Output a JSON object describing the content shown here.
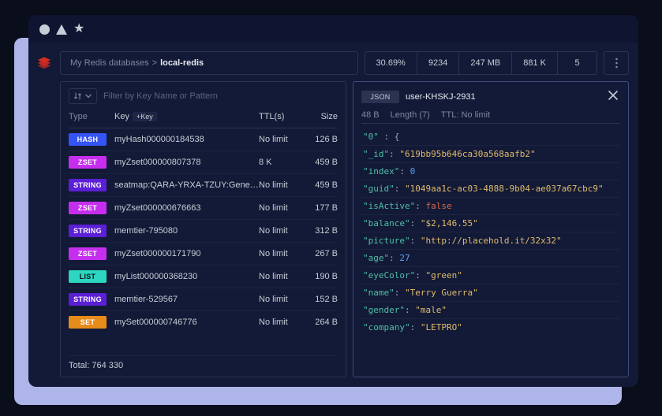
{
  "breadcrumb": {
    "root": "My Redis databases",
    "sep": ">",
    "current": "local-redis"
  },
  "stats": {
    "pct": "30.69%",
    "s1": "9234",
    "size": "247 MB",
    "keys": "881 K",
    "extra": "5"
  },
  "filter": {
    "placeholder": "Filter by Key Name or Pattern"
  },
  "headers": {
    "type": "Type",
    "key": "Key",
    "add": "+Key",
    "ttl": "TTL(s)",
    "size": "Size"
  },
  "rows": [
    {
      "type": "HASH",
      "key": "myHash000000184538",
      "ttl": "No limit",
      "size": "126 B"
    },
    {
      "type": "ZSET",
      "key": "myZset000000807378",
      "ttl": "8 K",
      "size": "459 B"
    },
    {
      "type": "STRING",
      "key": "seatmap:QARA-YRXA-TZUY:General:UF",
      "ttl": "No limit",
      "size": "459 B"
    },
    {
      "type": "ZSET",
      "key": "myZset000000676663",
      "ttl": "No limit",
      "size": "177 B"
    },
    {
      "type": "STRING",
      "key": "memtier-795080",
      "ttl": "No limit",
      "size": "312 B"
    },
    {
      "type": "ZSET",
      "key": "myZset000000171790",
      "ttl": "No limit",
      "size": "267 B"
    },
    {
      "type": "LIST",
      "key": "myList000000368230",
      "ttl": "No limit",
      "size": "190 B"
    },
    {
      "type": "STRING",
      "key": "memtier-529567",
      "ttl": "No limit",
      "size": "152 B"
    },
    {
      "type": "SET",
      "key": "mySet000000746776",
      "ttl": "No limit",
      "size": "264 B"
    }
  ],
  "footer": {
    "total": "Total: 764 330"
  },
  "detail": {
    "type_tag": "JSON",
    "name": "user-KHSKJ-2931",
    "size": "48 B",
    "length": "Length (7)",
    "ttl": "TTL: No limit",
    "json": [
      {
        "raw": true,
        "k": "\"0\"",
        "rest": " : {"
      },
      {
        "k": "\"_id\"",
        "v": "\"619bb95b646ca30a568aafb2\"",
        "t": "str"
      },
      {
        "k": "\"index\"",
        "v": "0",
        "t": "num"
      },
      {
        "k": "\"guid\"",
        "v": "\"1049aa1c-ac03-4888-9b04-ae037a67cbc9\"",
        "t": "str"
      },
      {
        "k": "\"isActive\"",
        "v": "false",
        "t": "bool"
      },
      {
        "k": "\"balance\"",
        "v": "\"$2,146.55\"",
        "t": "str"
      },
      {
        "k": "\"picture\"",
        "v": "\"http://placehold.it/32x32\"",
        "t": "str"
      },
      {
        "k": "\"age\"",
        "v": "27",
        "t": "num"
      },
      {
        "k": "\"eyeColor\"",
        "v": "\"green\"",
        "t": "str"
      },
      {
        "k": "\"name\"",
        "v": "\"Terry Guerra\"",
        "t": "str"
      },
      {
        "k": "\"gender\"",
        "v": "\"male\"",
        "t": "str"
      },
      {
        "k": "\"company\"",
        "v": "\"LETPRO\"",
        "t": "str"
      }
    ]
  }
}
